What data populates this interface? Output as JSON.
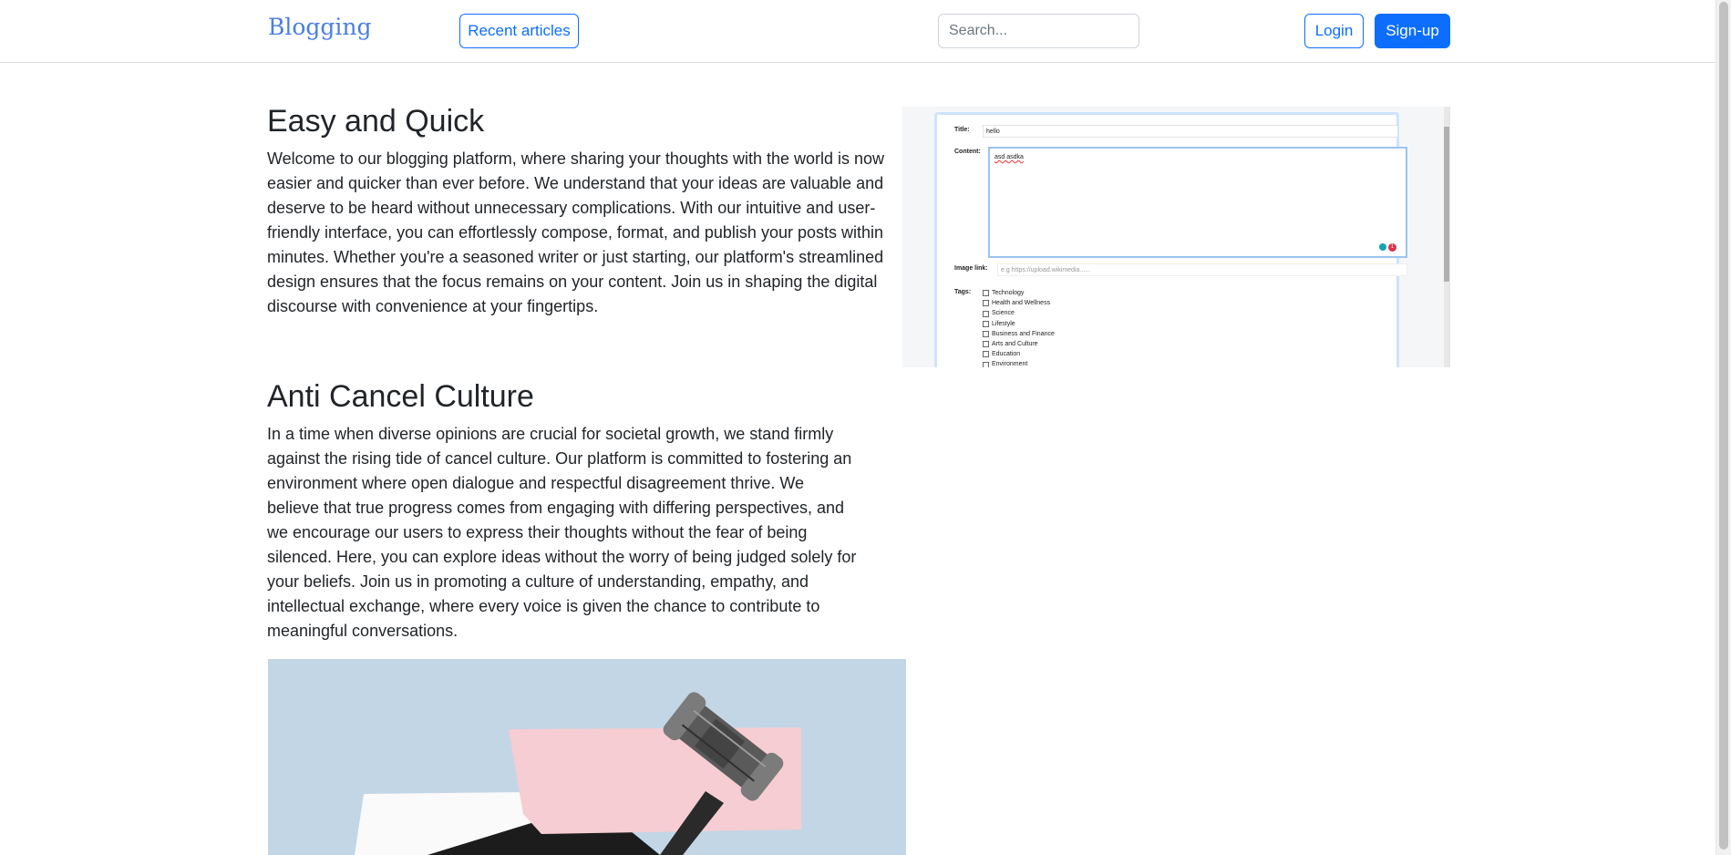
{
  "navbar": {
    "brand": "Blogging",
    "recent_label": "Recent articles",
    "search_placeholder": "Search...",
    "login_label": "Login",
    "signup_label": "Sign-up"
  },
  "sections": {
    "easy": {
      "title": "Easy and Quick",
      "body": "Welcome to our blogging platform, where sharing your thoughts with the world is now easier and quicker than ever before. We understand that your ideas are valuable and deserve to be heard without unnecessary complications. With our intuitive and user-friendly interface, you can effortlessly compose, format, and publish your posts within minutes. Whether you're a seasoned writer or just starting, our platform's streamlined design ensures that the focus remains on your content. Join us in shaping the digital discourse with convenience at your fingertips."
    },
    "cancel": {
      "title": "Anti Cancel Culture",
      "body": "In a time when diverse opinions are crucial for societal growth, we stand firmly against the rising tide of cancel culture. Our platform is committed to fostering an environment where open dialogue and respectful disagreement thrive. We believe that true progress comes from engaging with differing perspectives, and we encourage our users to express their thoughts without the fear of being silenced. Here, you can explore ideas without the worry of being judged solely for your beliefs. Join us in promoting a culture of understanding, empathy, and intellectual exchange, where every voice is given the chance to contribute to meaningful conversations."
    }
  },
  "form_screenshot": {
    "title_label": "Title:",
    "title_value": "hello",
    "content_label": "Content:",
    "content_value": "asd asdka",
    "badge_count": "1",
    "image_label": "Image link:",
    "image_placeholder": "e.g https://upload.wikimedia......",
    "tags_label": "Tags:",
    "tags": [
      "Technology",
      "Health and Wellness",
      "Science",
      "Lifestyle",
      "Business and Finance",
      "Arts and Culture",
      "Education",
      "Environment"
    ]
  },
  "colors": {
    "brand": "#4a7fe0",
    "primary": "#0d6efd",
    "border": "#dee2e6",
    "text": "#212529",
    "gavel_bg": "#c3d6e6",
    "pink_paper": "#f6cdd2"
  }
}
